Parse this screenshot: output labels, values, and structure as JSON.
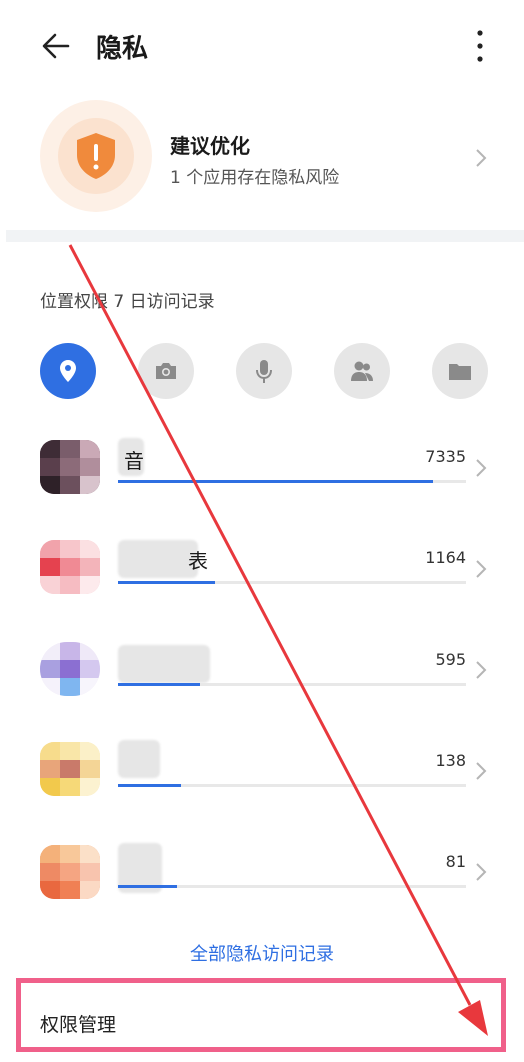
{
  "header": {
    "title": "隐私"
  },
  "suggestion": {
    "title": "建议优化",
    "subtitle": "1 个应用存在隐私风险"
  },
  "location_section": {
    "title": "位置权限 7 日访问记录"
  },
  "categories": [
    {
      "icon": "location-pin-icon",
      "active": true
    },
    {
      "icon": "camera-icon",
      "active": false
    },
    {
      "icon": "microphone-icon",
      "active": false
    },
    {
      "icon": "contacts-icon",
      "active": false
    },
    {
      "icon": "folder-icon",
      "active": false
    }
  ],
  "apps": [
    {
      "name_visible": "音",
      "count": "7335",
      "fraction": 0.905
    },
    {
      "name_visible": "表",
      "count": "1164",
      "fraction": 0.28
    },
    {
      "name_visible": "",
      "count": "595",
      "fraction": 0.235
    },
    {
      "name_visible": "",
      "count": "138",
      "fraction": 0.18
    },
    {
      "name_visible": "",
      "count": "81",
      "fraction": 0.17
    }
  ],
  "all_records_link": "全部隐私访问记录",
  "permission_management": "权限管理",
  "colors": {
    "accent": "#2f6fe2",
    "warning": "#f08a3c",
    "highlight_box": "#f0608a",
    "arrow": "#e8383d"
  }
}
